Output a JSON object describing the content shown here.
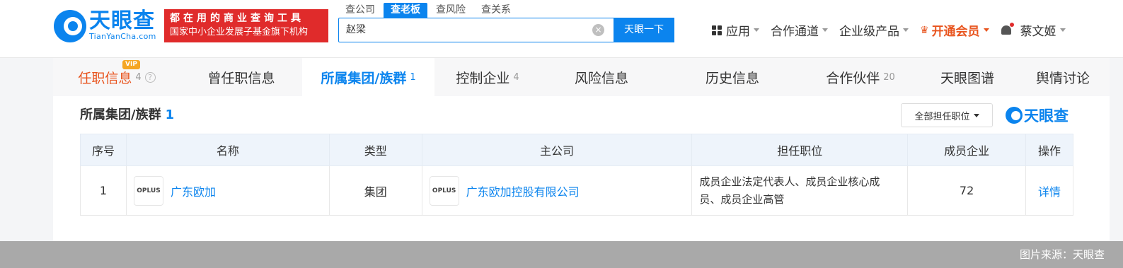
{
  "header": {
    "logo_cn": "天眼查",
    "logo_en": "TianYanCha.com",
    "banner_line1": "都在用的商业查询工具",
    "banner_line2": "国家中小企业发展子基金旗下机构"
  },
  "search": {
    "tabs": [
      "查公司",
      "查老板",
      "查风险",
      "查关系"
    ],
    "value": "赵梁",
    "clear_glyph": "×",
    "button_label": "天眼一下"
  },
  "nav": {
    "apps": "应用",
    "channels": "合作通道",
    "enterprise": "企业级产品",
    "vip": "开通会员",
    "user": "蔡文姬"
  },
  "tabs": [
    {
      "label": "任职信息",
      "count": "4"
    },
    {
      "label": "曾任职信息",
      "count": ""
    },
    {
      "label": "所属集团/族群",
      "count": "1"
    },
    {
      "label": "控制企业",
      "count": "4"
    },
    {
      "label": "风险信息",
      "count": ""
    },
    {
      "label": "历史信息",
      "count": ""
    },
    {
      "label": "合作伙伴",
      "count": "20"
    },
    {
      "label": "天眼图谱",
      "count": ""
    },
    {
      "label": "舆情讨论",
      "count": ""
    }
  ],
  "vip_badge": "VIP",
  "help_glyph": "?",
  "section": {
    "title": "所属集团/族群",
    "count": "1",
    "filter_label": "全部担任职位",
    "watermark": "天眼查"
  },
  "table": {
    "headers": [
      "序号",
      "名称",
      "类型",
      "主公司",
      "担任职位",
      "成员企业",
      "操作"
    ],
    "rows": [
      {
        "index": "1",
        "logo_text": "OPLUS",
        "name": "广东欧加",
        "type": "集团",
        "parent_logo_text": "OPLUS",
        "parent": "广东欧加控股有限公司",
        "position": "成员企业法定代表人、成员企业核心成员、成员企业高管",
        "members": "72",
        "action": "详情"
      }
    ]
  },
  "footer": {
    "source": "图片来源：天眼查"
  },
  "colors": {
    "brand": "#0b84ee",
    "banner_red": "#e02b2b",
    "vip_orange": "#e8541e"
  }
}
